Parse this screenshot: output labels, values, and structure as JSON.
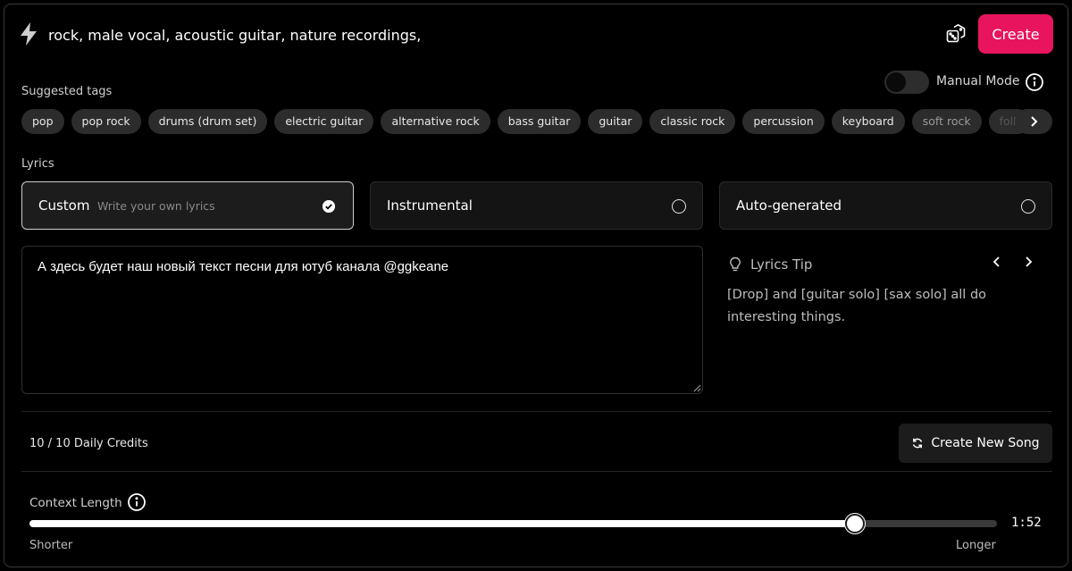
{
  "prompt": {
    "value": "rock, male vocal, acoustic guitar, nature recordings,"
  },
  "header": {
    "create_label": "Create"
  },
  "manual_mode": {
    "label": "Manual Mode",
    "enabled": false
  },
  "suggested_tags": {
    "label": "Suggested tags",
    "items": [
      "pop",
      "pop rock",
      "drums (drum set)",
      "electric guitar",
      "alternative rock",
      "bass guitar",
      "guitar",
      "classic rock",
      "percussion",
      "keyboard",
      "soft rock",
      "folk"
    ]
  },
  "lyrics": {
    "label": "Lyrics",
    "options": [
      {
        "title": "Custom",
        "subtitle": "Write your own lyrics",
        "selected": true
      },
      {
        "title": "Instrumental",
        "subtitle": "",
        "selected": false
      },
      {
        "title": "Auto-generated",
        "subtitle": "",
        "selected": false
      }
    ],
    "text": "А здесь будет наш новый текст песни для ютуб канала @ggkeane"
  },
  "tip": {
    "title": "Lyrics Tip",
    "text": "[Drop] and [guitar solo] [sax solo] all do interesting things."
  },
  "credits": {
    "text": "10 / 10 Daily Credits"
  },
  "new_song": {
    "label": "Create New Song"
  },
  "context": {
    "label": "Context Length",
    "value_text": "1:52",
    "slider_fraction": 0.853,
    "min_label": "Shorter",
    "max_label": "Longer"
  },
  "colors": {
    "accent": "#e8155e",
    "background": "#000000",
    "card": "#141414"
  }
}
